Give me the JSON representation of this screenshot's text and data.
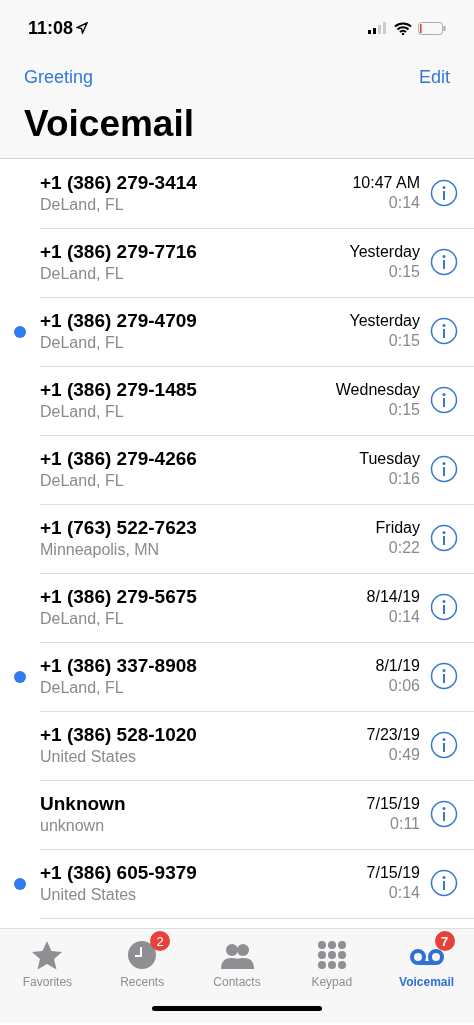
{
  "status_bar": {
    "time": "11:08"
  },
  "nav": {
    "left": "Greeting",
    "right": "Edit"
  },
  "title": "Voicemail",
  "voicemails": [
    {
      "caller": "+1 (386) 279-3414",
      "location": "DeLand, FL",
      "date": "10:47 AM",
      "duration": "0:14",
      "unread": false
    },
    {
      "caller": "+1 (386) 279-7716",
      "location": "DeLand, FL",
      "date": "Yesterday",
      "duration": "0:15",
      "unread": false
    },
    {
      "caller": "+1 (386) 279-4709",
      "location": "DeLand, FL",
      "date": "Yesterday",
      "duration": "0:15",
      "unread": true
    },
    {
      "caller": "+1 (386) 279-1485",
      "location": "DeLand, FL",
      "date": "Wednesday",
      "duration": "0:15",
      "unread": false
    },
    {
      "caller": "+1 (386) 279-4266",
      "location": "DeLand, FL",
      "date": "Tuesday",
      "duration": "0:16",
      "unread": false
    },
    {
      "caller": "+1 (763) 522-7623",
      "location": "Minneapolis, MN",
      "date": "Friday",
      "duration": "0:22",
      "unread": false
    },
    {
      "caller": "+1 (386) 279-5675",
      "location": "DeLand, FL",
      "date": "8/14/19",
      "duration": "0:14",
      "unread": false
    },
    {
      "caller": "+1 (386) 337-8908",
      "location": "DeLand, FL",
      "date": "8/1/19",
      "duration": "0:06",
      "unread": true
    },
    {
      "caller": "+1 (386) 528-1020",
      "location": "United States",
      "date": "7/23/19",
      "duration": "0:49",
      "unread": false
    },
    {
      "caller": "Unknown",
      "location": "unknown",
      "date": "7/15/19",
      "duration": "0:11",
      "unread": false
    },
    {
      "caller": "+1 (386) 605-9379",
      "location": "United States",
      "date": "7/15/19",
      "duration": "0:14",
      "unread": true
    }
  ],
  "tab_bar": [
    {
      "kind": "star",
      "label": "Favorites",
      "selected": false
    },
    {
      "kind": "clock",
      "label": "Recents",
      "selected": false,
      "badge": "2"
    },
    {
      "kind": "people",
      "label": "Contacts",
      "selected": false
    },
    {
      "kind": "keypad",
      "label": "Keypad",
      "selected": false
    },
    {
      "kind": "voicemail",
      "label": "Voicemail",
      "selected": true,
      "badge": "7"
    }
  ]
}
